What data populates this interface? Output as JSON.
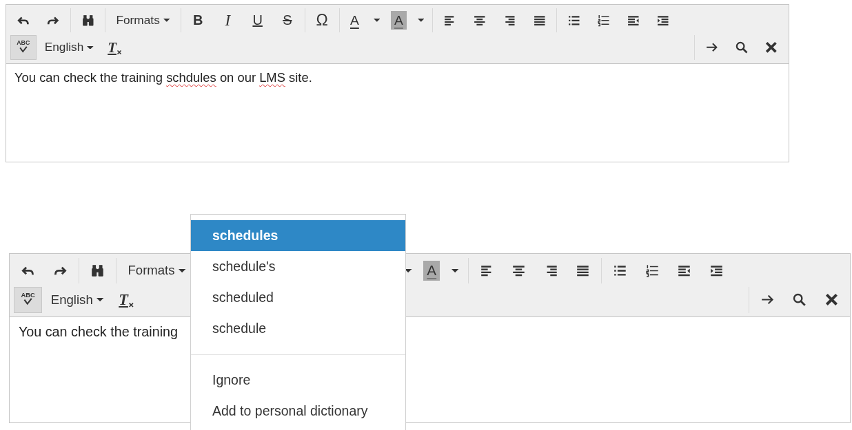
{
  "editors": [
    {
      "toolbar": {
        "row_1": [
          {
            "kind": "undo"
          },
          {
            "kind": "redo"
          },
          {
            "kind": "find"
          },
          {
            "kind": "formats",
            "label": "Formats"
          },
          {
            "kind": "bold",
            "label": "B"
          },
          {
            "kind": "italic",
            "label": "I"
          },
          {
            "kind": "underline",
            "label": "U"
          },
          {
            "kind": "strike",
            "label": "S"
          },
          {
            "kind": "charmap",
            "label": "Ω"
          },
          {
            "kind": "forecolor",
            "label": "A"
          },
          {
            "kind": "forecolor_menu"
          },
          {
            "kind": "backcolor",
            "label": "A"
          },
          {
            "kind": "backcolor_menu"
          },
          {
            "kind": "align_left"
          },
          {
            "kind": "align_center"
          },
          {
            "kind": "align_right"
          },
          {
            "kind": "justify"
          },
          {
            "kind": "bullets"
          },
          {
            "kind": "numbers"
          },
          {
            "kind": "outdent"
          },
          {
            "kind": "indent"
          }
        ],
        "row_2": [
          {
            "kind": "spellcheck",
            "label": "ABC",
            "on": true
          },
          {
            "kind": "language",
            "label": "English"
          },
          {
            "kind": "clear_format",
            "label": "T"
          }
        ],
        "row_2_right": [
          {
            "kind": "arrow"
          },
          {
            "kind": "search"
          },
          {
            "kind": "close"
          }
        ]
      },
      "content": [
        {
          "text": "You can check the training ",
          "misspelled": false
        },
        {
          "text": "schdules",
          "misspelled": true
        },
        {
          "text": " on our ",
          "misspelled": false
        },
        {
          "text": "LMS",
          "misspelled": true
        },
        {
          "text": " site.",
          "misspelled": false
        }
      ]
    },
    {
      "toolbar": {
        "row_1": [
          {
            "kind": "undo"
          },
          {
            "kind": "redo"
          },
          {
            "kind": "find"
          },
          {
            "kind": "formats",
            "label": "Formats"
          },
          {
            "kind": "forecolor_menu"
          },
          {
            "kind": "backcolor",
            "label": "A"
          },
          {
            "kind": "backcolor_menu"
          },
          {
            "kind": "align_left"
          },
          {
            "kind": "align_center"
          },
          {
            "kind": "align_right"
          },
          {
            "kind": "justify"
          },
          {
            "kind": "bullets"
          },
          {
            "kind": "numbers"
          },
          {
            "kind": "outdent"
          },
          {
            "kind": "indent"
          }
        ],
        "row_2": [
          {
            "kind": "spellcheck",
            "label": "ABC",
            "on": true
          },
          {
            "kind": "language",
            "label": "English"
          },
          {
            "kind": "clear_format",
            "label": "T"
          }
        ],
        "row_2_right": [
          {
            "kind": "arrow"
          },
          {
            "kind": "search"
          },
          {
            "kind": "close"
          }
        ]
      },
      "content": [
        {
          "text": "You can check the training",
          "misspelled": false
        }
      ]
    }
  ],
  "context_menu": {
    "suggestions": [
      {
        "label": "schedules",
        "selected": true
      },
      {
        "label": "schedule's",
        "selected": false
      },
      {
        "label": "scheduled",
        "selected": false
      },
      {
        "label": "schedule",
        "selected": false
      }
    ],
    "actions": [
      {
        "label": "Ignore"
      },
      {
        "label": "Add to personal dictionary"
      }
    ]
  }
}
